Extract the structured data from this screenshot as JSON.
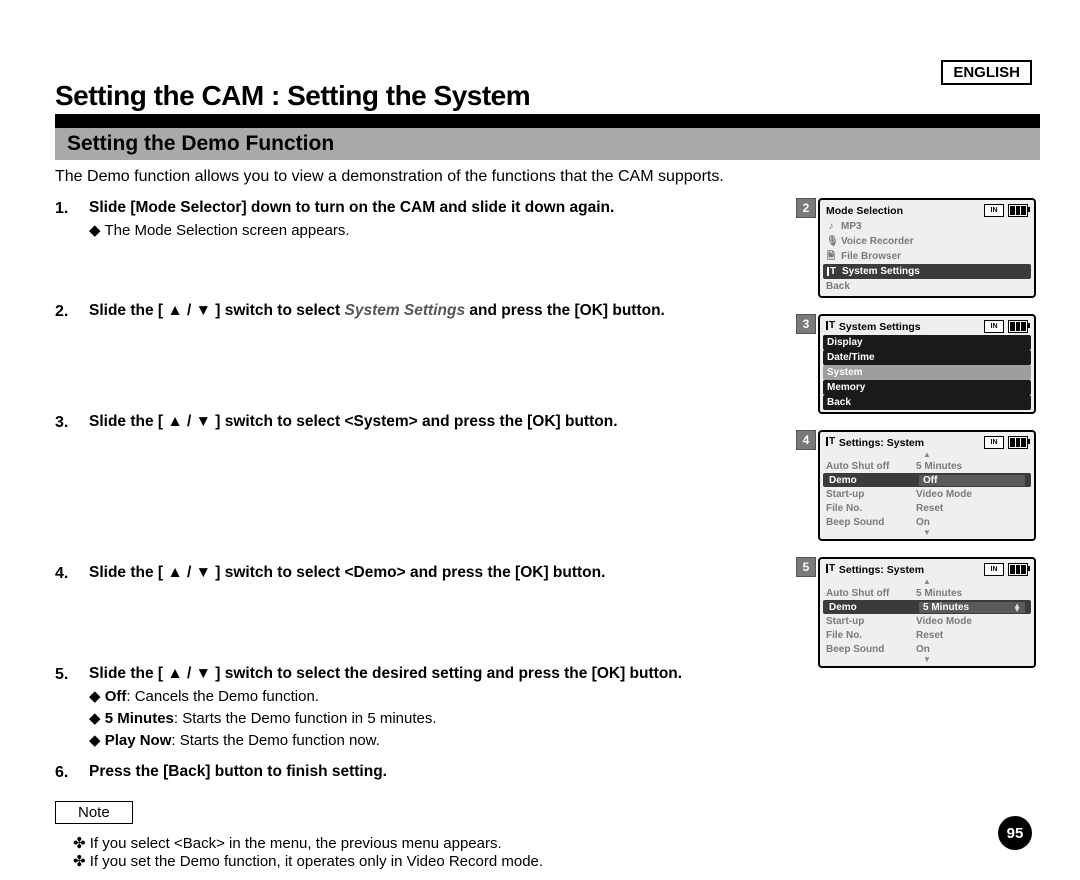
{
  "lang": "ENGLISH",
  "main_title": "Setting the CAM : Setting the System",
  "subtitle": "Setting the Demo Function",
  "intro": "The Demo function allows you to view a demonstration of the functions that the CAM supports.",
  "page_number": "95",
  "note_label": "Note",
  "steps": [
    {
      "title": "Slide [Mode Selector] down to turn on the CAM and slide it down again.",
      "subs": [
        "The Mode Selection screen appears."
      ]
    },
    {
      "title_pre": "Slide the [ ▲ / ▼ ] switch to select ",
      "title_em": "System Settings",
      "title_post": " and press the [OK] button."
    },
    {
      "title": "Slide the [ ▲ / ▼ ] switch to select <System> and press the [OK] button."
    },
    {
      "title": "Slide the [ ▲ / ▼ ] switch to select <Demo> and press the [OK] button."
    },
    {
      "title": "Slide the [ ▲ / ▼ ] switch to select the desired setting and press the [OK] button.",
      "subs_kv": [
        {
          "k": "Off",
          "v": ": Cancels the Demo function."
        },
        {
          "k": "5 Minutes",
          "v": ": Starts the Demo function in 5 minutes."
        },
        {
          "k": "Play Now",
          "v": ": Starts the Demo function now."
        }
      ]
    },
    {
      "title": "Press the [Back] button to finish setting."
    }
  ],
  "notes": [
    "If you select <Back> in the menu, the previous menu appears.",
    "If you set the Demo function, it operates only in Video Record mode."
  ],
  "screens": {
    "s2": {
      "num": "2",
      "title": "Mode Selection",
      "items": [
        {
          "icon": "♪",
          "label": "MP3"
        },
        {
          "icon": "🎤",
          "label": "Voice Recorder"
        },
        {
          "icon": "🗎",
          "label": "File Browser"
        },
        {
          "icon": "tool",
          "label": "System Settings",
          "sel": true
        },
        {
          "label": "Back"
        }
      ]
    },
    "s3": {
      "num": "3",
      "title_icon": "tool",
      "title": "System Settings",
      "rows": [
        {
          "label": "Display",
          "style": "black"
        },
        {
          "label": "Date/Time",
          "style": "black"
        },
        {
          "label": "System",
          "style": "light"
        },
        {
          "label": "Memory",
          "style": "black"
        },
        {
          "label": "Back",
          "style": "black"
        }
      ]
    },
    "s4": {
      "num": "4",
      "title_icon": "tool",
      "title": "Settings: System",
      "rows": [
        {
          "c1": "Auto Shut off",
          "c2": "5 Minutes"
        },
        {
          "c1": "Demo",
          "c2": "Off",
          "sel": true
        },
        {
          "c1": "Start-up",
          "c2": "Video Mode"
        },
        {
          "c1": "File No.",
          "c2": "Reset"
        },
        {
          "c1": "Beep Sound",
          "c2": "On"
        }
      ]
    },
    "s5": {
      "num": "5",
      "title_icon": "tool",
      "title": "Settings: System",
      "rows": [
        {
          "c1": "Auto Shut off",
          "c2": "5 Minutes"
        },
        {
          "c1": "Demo",
          "c2": "5 Minutes",
          "sel": true,
          "arrows": true
        },
        {
          "c1": "Start-up",
          "c2": "Video Mode"
        },
        {
          "c1": "File No.",
          "c2": "Reset"
        },
        {
          "c1": "Beep Sound",
          "c2": "On"
        }
      ]
    }
  }
}
